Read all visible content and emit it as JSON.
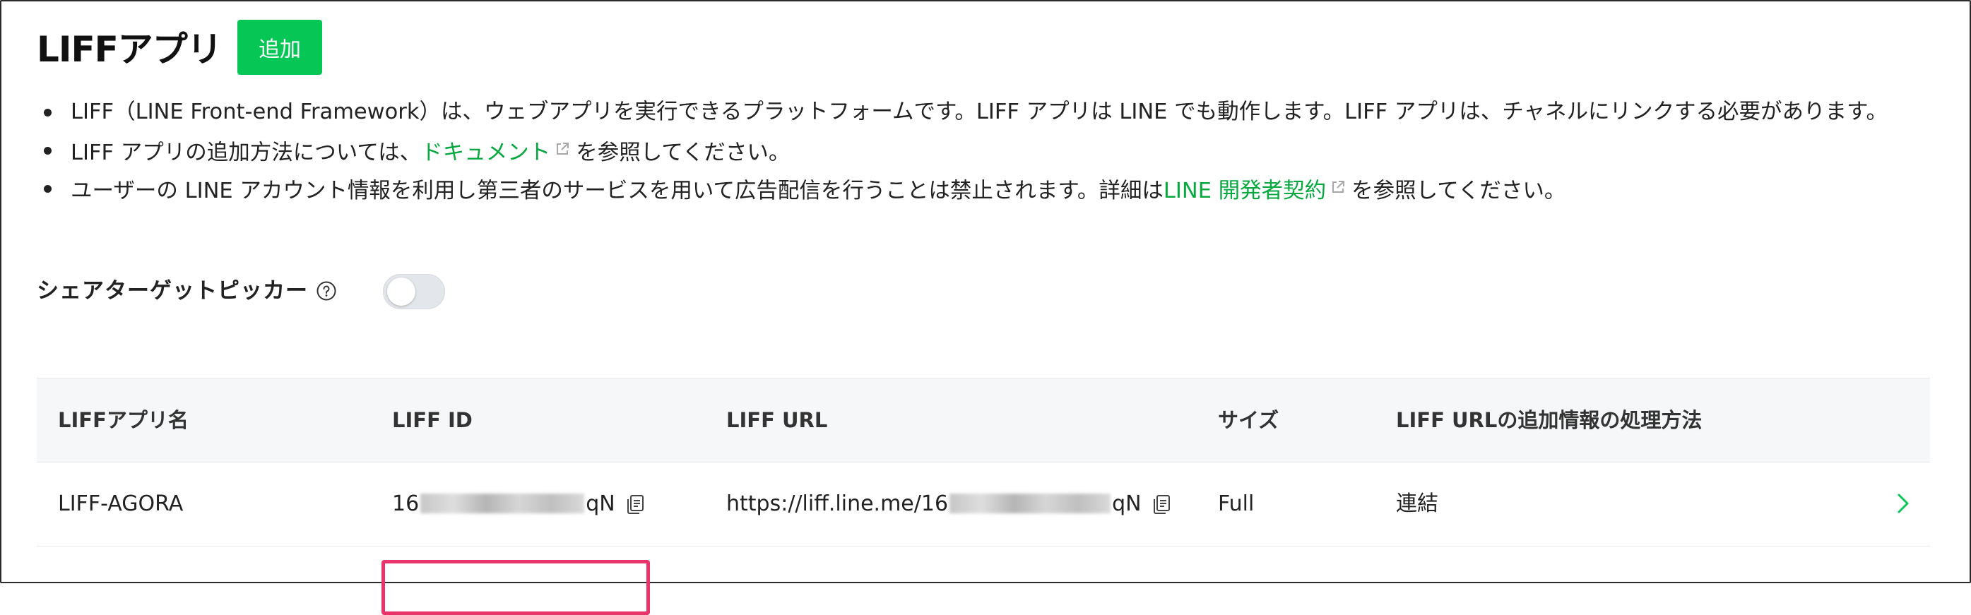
{
  "header": {
    "title": "LIFFアプリ",
    "add_label": "追加"
  },
  "info": {
    "line1": "LIFF（LINE Front-end Framework）は、ウェブアプリを実行できるプラットフォームです。LIFF アプリは LINE でも動作します。LIFF アプリは、チャネルにリンクする必要があります。",
    "line2_prefix": "LIFF アプリの追加方法については、",
    "line2_link": "ドキュメント",
    "line2_suffix": "を参照してください。",
    "line3_prefix": "ユーザーの LINE アカウント情報を利用し第三者のサービスを用いて広告配信を行うことは禁止されます。詳細は",
    "line3_link": "LINE 開発者契約",
    "line3_suffix": "を参照してください。"
  },
  "share_target_picker": {
    "label": "シェアターゲットピッカー",
    "enabled": false
  },
  "table": {
    "headers": {
      "name": "LIFFアプリ名",
      "id": "LIFF ID",
      "url": "LIFF URL",
      "size": "サイズ",
      "mode": "LIFF URLの追加情報の処理方法"
    },
    "rows": [
      {
        "name": "LIFF-AGORA",
        "id_start": "16",
        "id_end": "qN",
        "url_start": "https://liff.line.me/16",
        "url_end": "qN",
        "size": "Full",
        "mode": "連結"
      }
    ]
  },
  "colors": {
    "accent_green": "#06c755",
    "link_green": "#06a83f",
    "highlight": "#e8336b"
  },
  "icons": [
    "help-icon",
    "external-link-icon",
    "copy-icon",
    "chevron-right-icon"
  ]
}
